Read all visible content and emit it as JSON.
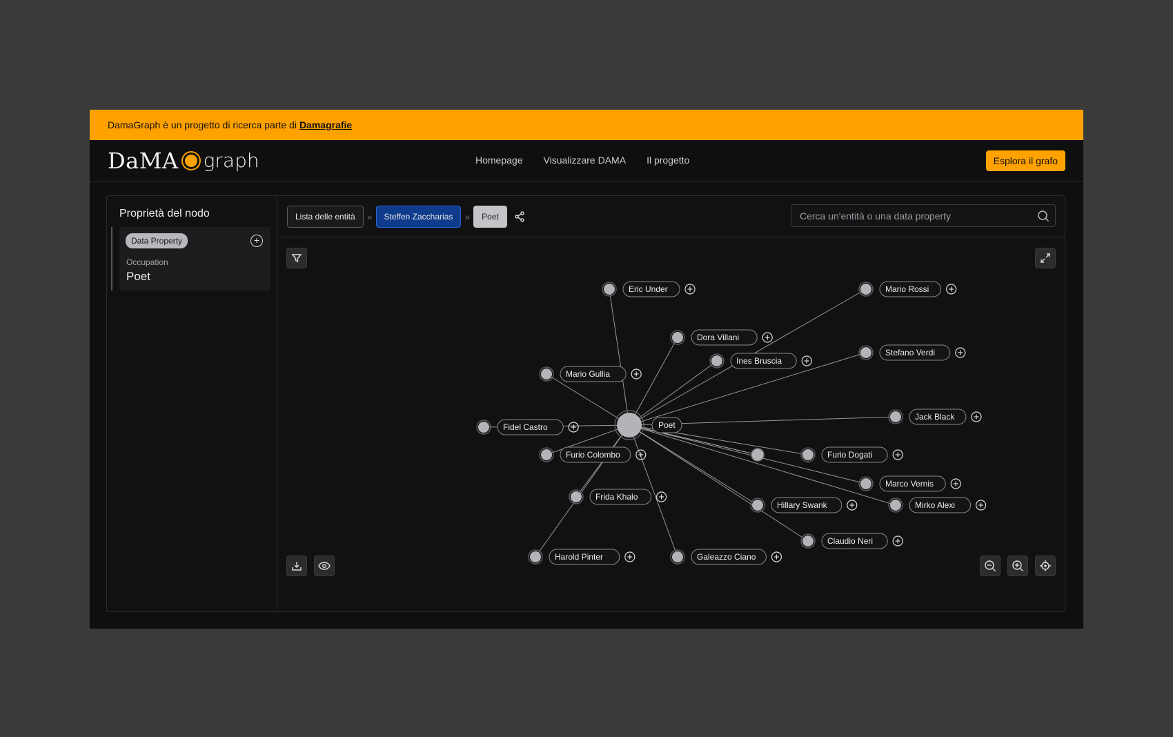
{
  "banner": {
    "text": "DamaGraph è un progetto di ricerca parte di",
    "link": "Damagrafie"
  },
  "logo": {
    "left": "DaMA",
    "right": "graph"
  },
  "nav": {
    "home": "Homepage",
    "viz": "Visualizzare DAMA",
    "project": "Il progetto",
    "cta": "Esplora il grafo"
  },
  "sidebar": {
    "title": "Proprietà del nodo",
    "badge": "Data Property",
    "key": "Occupation",
    "value": "Poet"
  },
  "breadcrumbs": {
    "list": "Lista delle entità",
    "entity": "Steffen Zaccharias",
    "current": "Poet"
  },
  "search": {
    "placeholder": "Cerca un'entità o una data property"
  },
  "icons": [
    "filter-icon",
    "expand-icon",
    "share-icon",
    "search-icon",
    "download-icon",
    "eye-icon",
    "zoom-out-icon",
    "zoom-in-icon",
    "locate-icon",
    "plus-circle-icon"
  ],
  "graph": {
    "center": "Poet",
    "nodes": [
      {
        "label": "Eric Under"
      },
      {
        "label": "Mario Rossi"
      },
      {
        "label": "Dora Villani"
      },
      {
        "label": "Ines Bruscia"
      },
      {
        "label": "Stefano Verdi"
      },
      {
        "label": "Mario Gullia"
      },
      {
        "label": "Jack Black"
      },
      {
        "label": "Fidel Castro"
      },
      {
        "label": "Furio Colombo"
      },
      {
        "label": "Furio Dogati"
      },
      {
        "label": "Marco Vernis"
      },
      {
        "label": "Frida Khalo"
      },
      {
        "label": "Hillary Swank"
      },
      {
        "label": "Mirko Alexi"
      },
      {
        "label": "Claudio Neri"
      },
      {
        "label": "Harold Pinter"
      },
      {
        "label": "Galeazzo Ciano"
      }
    ],
    "colors": {
      "node": "#b4b4b8",
      "edge": "#b0b0b4",
      "labelBorder": "#8a8a8e"
    }
  }
}
